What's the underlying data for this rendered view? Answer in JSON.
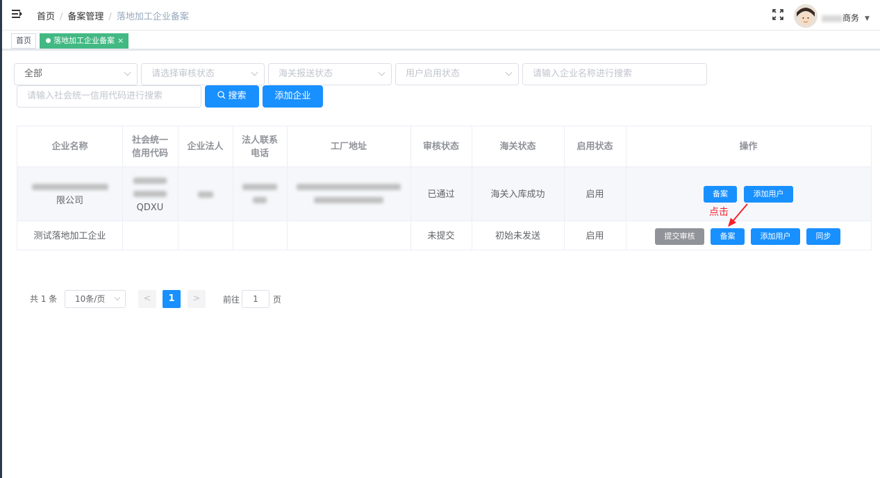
{
  "header": {
    "breadcrumb": [
      "首页",
      "备案管理",
      "落地加工企业备案"
    ],
    "username_suffix": "商务"
  },
  "tags": {
    "home": "首页",
    "active": "落地加工企业备案",
    "close": "×"
  },
  "filters": {
    "category_value": "全部",
    "audit_status_placeholder": "请选择审核状态",
    "customs_status_placeholder": "海关报送状态",
    "user_status_placeholder": "用户启用状态",
    "company_name_placeholder": "请输入企业名称进行搜索",
    "credit_code_placeholder": "请输入社会统一信用代码进行搜索",
    "search_label": "搜索",
    "add_company_label": "添加企业"
  },
  "table": {
    "headers": [
      "企业名称",
      "社会统一信用代码",
      "企业法人",
      "法人联系电话",
      "工厂地址",
      "审核状态",
      "海关状态",
      "启用状态",
      "操作"
    ],
    "rows": [
      {
        "name_tail": "限公司",
        "credit_tail": "QDXU",
        "audit": "已通过",
        "customs": "海关入库成功",
        "enabled": "启用",
        "actions": [
          "备案",
          "添加用户"
        ]
      },
      {
        "name": "测试落地加工企业",
        "audit": "未提交",
        "customs": "初始未发送",
        "enabled": "启用",
        "actions": [
          "提交审核",
          "备案",
          "添加用户",
          "同步"
        ]
      }
    ]
  },
  "annotation": "点击",
  "pagination": {
    "total": "共 1 条",
    "page_size": "10条/页",
    "prev": "<",
    "current": "1",
    "next": ">",
    "goto_label": "前往",
    "goto_value": "1",
    "goto_suffix": "页"
  },
  "colors": {
    "primary": "#1890ff",
    "tag_active": "#42b983",
    "gray_button": "#909399",
    "annotation": "#f5222d"
  }
}
